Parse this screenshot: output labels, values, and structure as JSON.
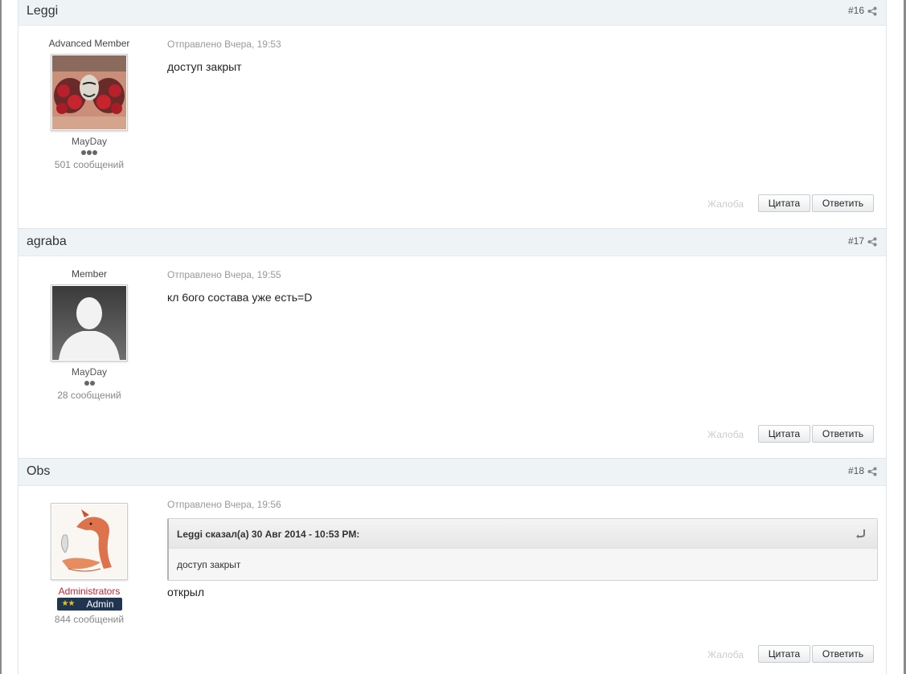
{
  "posts": [
    {
      "author": "Leggi",
      "number": "#16",
      "member_title": "Advanced Member",
      "group": "MayDay",
      "pips": 3,
      "post_count": "501 сообщений",
      "posted": "Отправлено Вчера, 19:53",
      "text": "доступ закрыт",
      "avatar": "tattoo-chest-avatar"
    },
    {
      "author": "agraba",
      "number": "#17",
      "member_title": "Member",
      "group": "MayDay",
      "pips": 2,
      "post_count": "28 сообщений",
      "posted": "Отправлено Вчера, 19:55",
      "text": "кл 6ого состава уже есть=D",
      "avatar": "default-silhouette-avatar"
    },
    {
      "author": "Obs",
      "number": "#18",
      "member_title": "Administrators",
      "badge": "Admin",
      "post_count": "844 сообщений",
      "posted": "Отправлено Вчера, 19:56",
      "quote": {
        "citation": "Leggi сказал(а) 30 Авг 2014 - 10:53 PM:",
        "text": "доступ закрыт"
      },
      "text": "открыл",
      "avatar": "fox-drawing-avatar"
    }
  ],
  "actions": {
    "report": "Жалоба",
    "quote": "Цитата",
    "reply": "Ответить"
  },
  "colors": {
    "header_bg": "#eef3f6",
    "admin_title": "#c0263a",
    "admin_badge": "#1f3550"
  }
}
